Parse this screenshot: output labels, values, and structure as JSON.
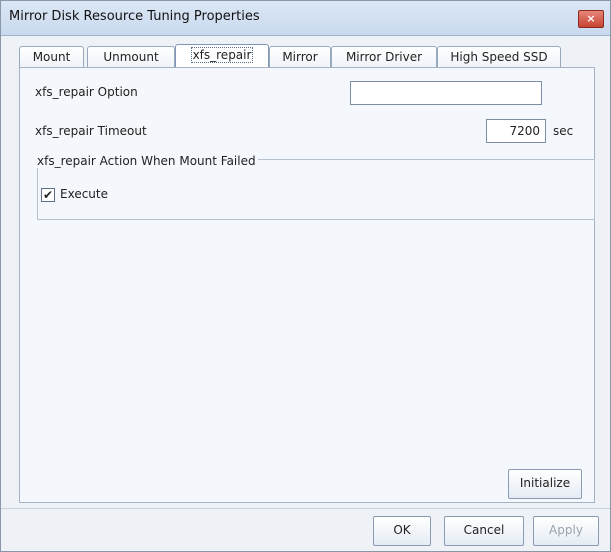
{
  "window": {
    "title": "Mirror Disk Resource Tuning Properties",
    "close_label": "×"
  },
  "tabs": [
    {
      "label": "Mount",
      "active": false
    },
    {
      "label": "Unmount",
      "active": false
    },
    {
      "label": "xfs_repair",
      "active": true
    },
    {
      "label": "Mirror",
      "active": false
    },
    {
      "label": "Mirror Driver",
      "active": false
    },
    {
      "label": "High Speed SSD",
      "active": false
    }
  ],
  "form": {
    "option_label": "xfs_repair Option",
    "option_value": "",
    "timeout_label": "xfs_repair Timeout",
    "timeout_value": "7200",
    "timeout_unit": "sec",
    "group_label": "xfs_repair Action When Mount Failed",
    "execute_label": "Execute",
    "execute_checked": "✔"
  },
  "buttons": {
    "initialize": "Initialize",
    "ok": "OK",
    "cancel": "Cancel",
    "apply": "Apply"
  },
  "colors": {
    "accent": "#7f97b6",
    "close_red": "#c84332"
  }
}
